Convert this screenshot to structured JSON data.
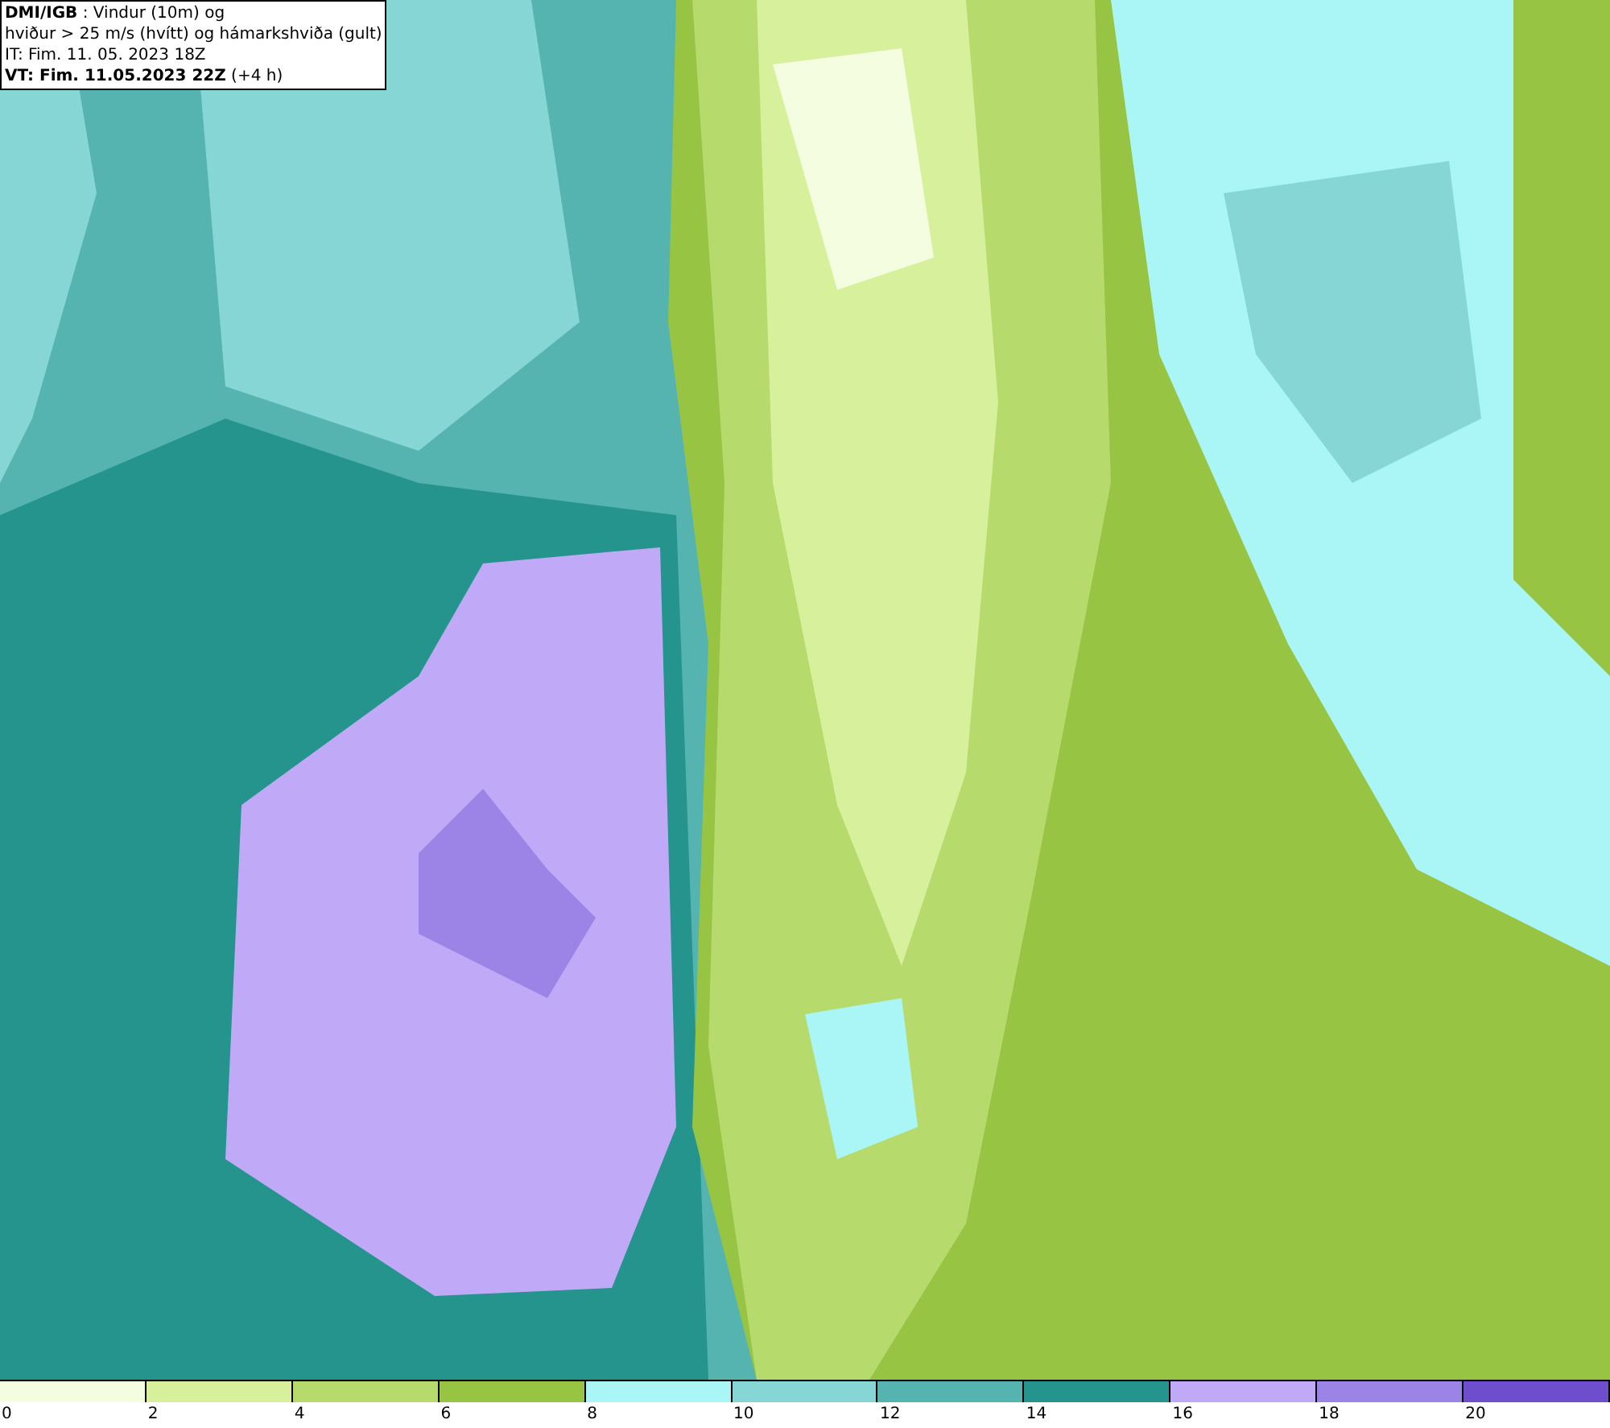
{
  "title_box": {
    "lines": [
      "**DMI/IGB** : Vindur (10m) og",
      "hviður > 25 m/s (hvítt) og hámarkshviða (gult)",
      "IT: Fim. 11. 05. 2023 18Z",
      "**VT: Fim. 11.05.2023 22Z** (+4 h)"
    ]
  },
  "legend": [
    {
      "label": "0",
      "color": "#f5fde0"
    },
    {
      "label": "2",
      "color": "#d6f09c"
    },
    {
      "label": "4",
      "color": "#b6da6c"
    },
    {
      "label": "6",
      "color": "#98c444"
    },
    {
      "label": "8",
      "color": "#aaf6f6"
    },
    {
      "label": "10",
      "color": "#86d6d6"
    },
    {
      "label": "12",
      "color": "#56b4b0"
    },
    {
      "label": "14",
      "color": "#24948c"
    },
    {
      "label": "16",
      "color": "#c0aaf8"
    },
    {
      "label": "18",
      "color": "#9c84e6"
    },
    {
      "label": "20",
      "color": "#6e4ecc"
    }
  ]
}
